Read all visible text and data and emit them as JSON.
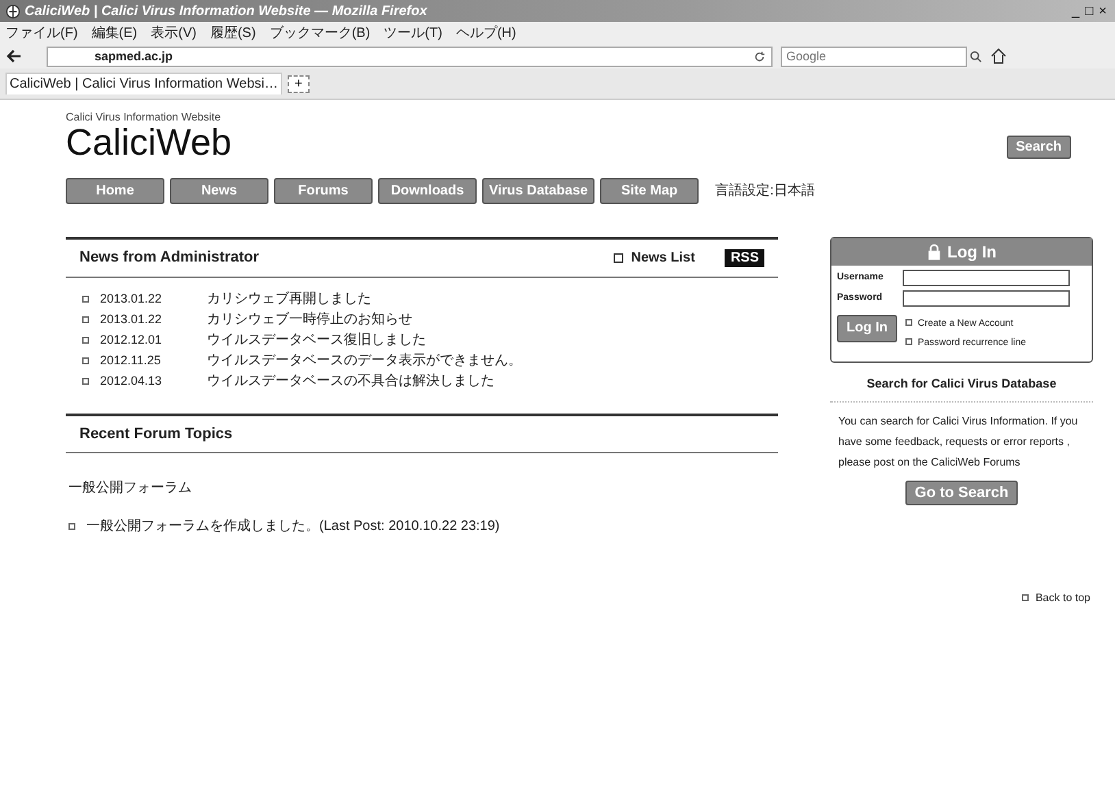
{
  "window": {
    "title": "CaliciWeb | Calici Virus Information Website — Mozilla Firefox",
    "controls": [
      "_",
      "□",
      "×"
    ]
  },
  "menu": [
    "ファイル(F)",
    "編集(E)",
    "表示(V)",
    "履歴(S)",
    "ブックマーク(B)",
    "ツール(T)",
    "ヘルプ(H)"
  ],
  "address": {
    "value": "sapmed.ac.jp"
  },
  "search": {
    "placeholder": "Google"
  },
  "tabs": [
    {
      "label": "CaliciWeb | Calici Virus Information Websi…",
      "selected": true
    }
  ],
  "new_tab": "+",
  "site": {
    "tagline": "Calici Virus Information Website",
    "logo": "CaliciWeb",
    "search_button": "Search"
  },
  "nav": [
    "Home",
    "News",
    "Forums",
    "Downloads",
    "Virus Database",
    "Site Map"
  ],
  "language": "言語設定:日本語",
  "news": {
    "title": "News from Administrator",
    "list_link": "News List",
    "rss": "RSS",
    "items": [
      {
        "date": "2013.01.22",
        "text": "カリシウェブ再開しました"
      },
      {
        "date": "2013.01.22",
        "text": "カリシウェブ一時停止のお知らせ"
      },
      {
        "date": "2012.12.01",
        "text": "ウイルスデータベース復旧しました"
      },
      {
        "date": "2012.11.25",
        "text": "ウイルスデータベースのデータ表示ができません。"
      },
      {
        "date": "2012.04.13",
        "text": "ウイルスデータベースの不具合は解決しました"
      }
    ]
  },
  "forum": {
    "title": "Recent Forum Topics",
    "category": "一般公開フォーラム",
    "topics": [
      {
        "text": "一般公開フォーラムを作成しました。(Last Post: 2010.10.22 23:19)"
      }
    ]
  },
  "login": {
    "title": "Log In",
    "username_label": "Username",
    "password_label": "Password",
    "button": "Log In",
    "links": [
      "Create a New Account",
      "Password recurrence line"
    ]
  },
  "db_search": {
    "title": "Search for Calici Virus Database",
    "text": "You can search for Calici Virus Information. If you have some feedback, requests or error reports , please post on the CaliciWeb Forums",
    "button": "Go to Search"
  },
  "back_to_top": "Back to top"
}
